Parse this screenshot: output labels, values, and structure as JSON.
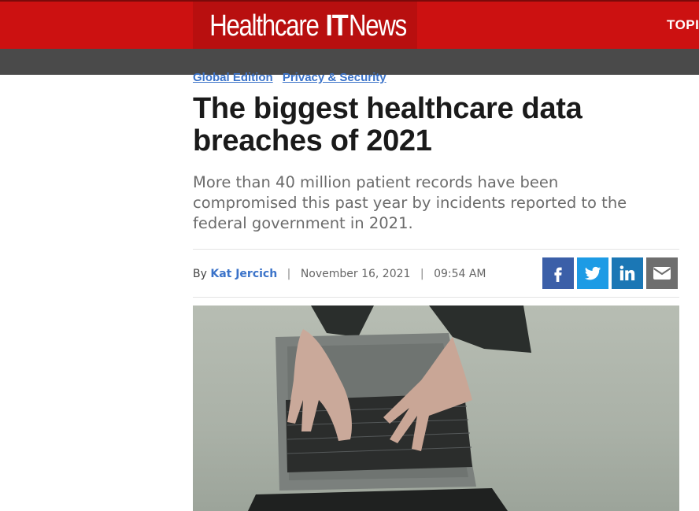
{
  "header": {
    "logo": {
      "word1": "Healthcare",
      "word2": "IT",
      "word3": "News"
    },
    "topics_label": "TOPI"
  },
  "breadcrumbs": [
    "Global Edition",
    "Privacy & Security"
  ],
  "article": {
    "title": "The biggest healthcare data breaches of 2021",
    "dek": "More than 40 million patient records have been compromised this past year by incidents reported to the federal government in 2021.",
    "byline": {
      "by": "By",
      "author": "Kat Jercich",
      "date": "November 16, 2021",
      "time": "09:54 AM"
    }
  },
  "share": [
    {
      "icon": "facebook-icon",
      "color": "#3b5fa8"
    },
    {
      "icon": "twitter-icon",
      "color": "#1d9be5"
    },
    {
      "icon": "linkedin-icon",
      "color": "#1b77b5"
    },
    {
      "icon": "email-icon",
      "color": "#6e6e6e"
    }
  ],
  "colors": {
    "brand_red": "#cc1111",
    "link_blue": "#3b73c9"
  }
}
